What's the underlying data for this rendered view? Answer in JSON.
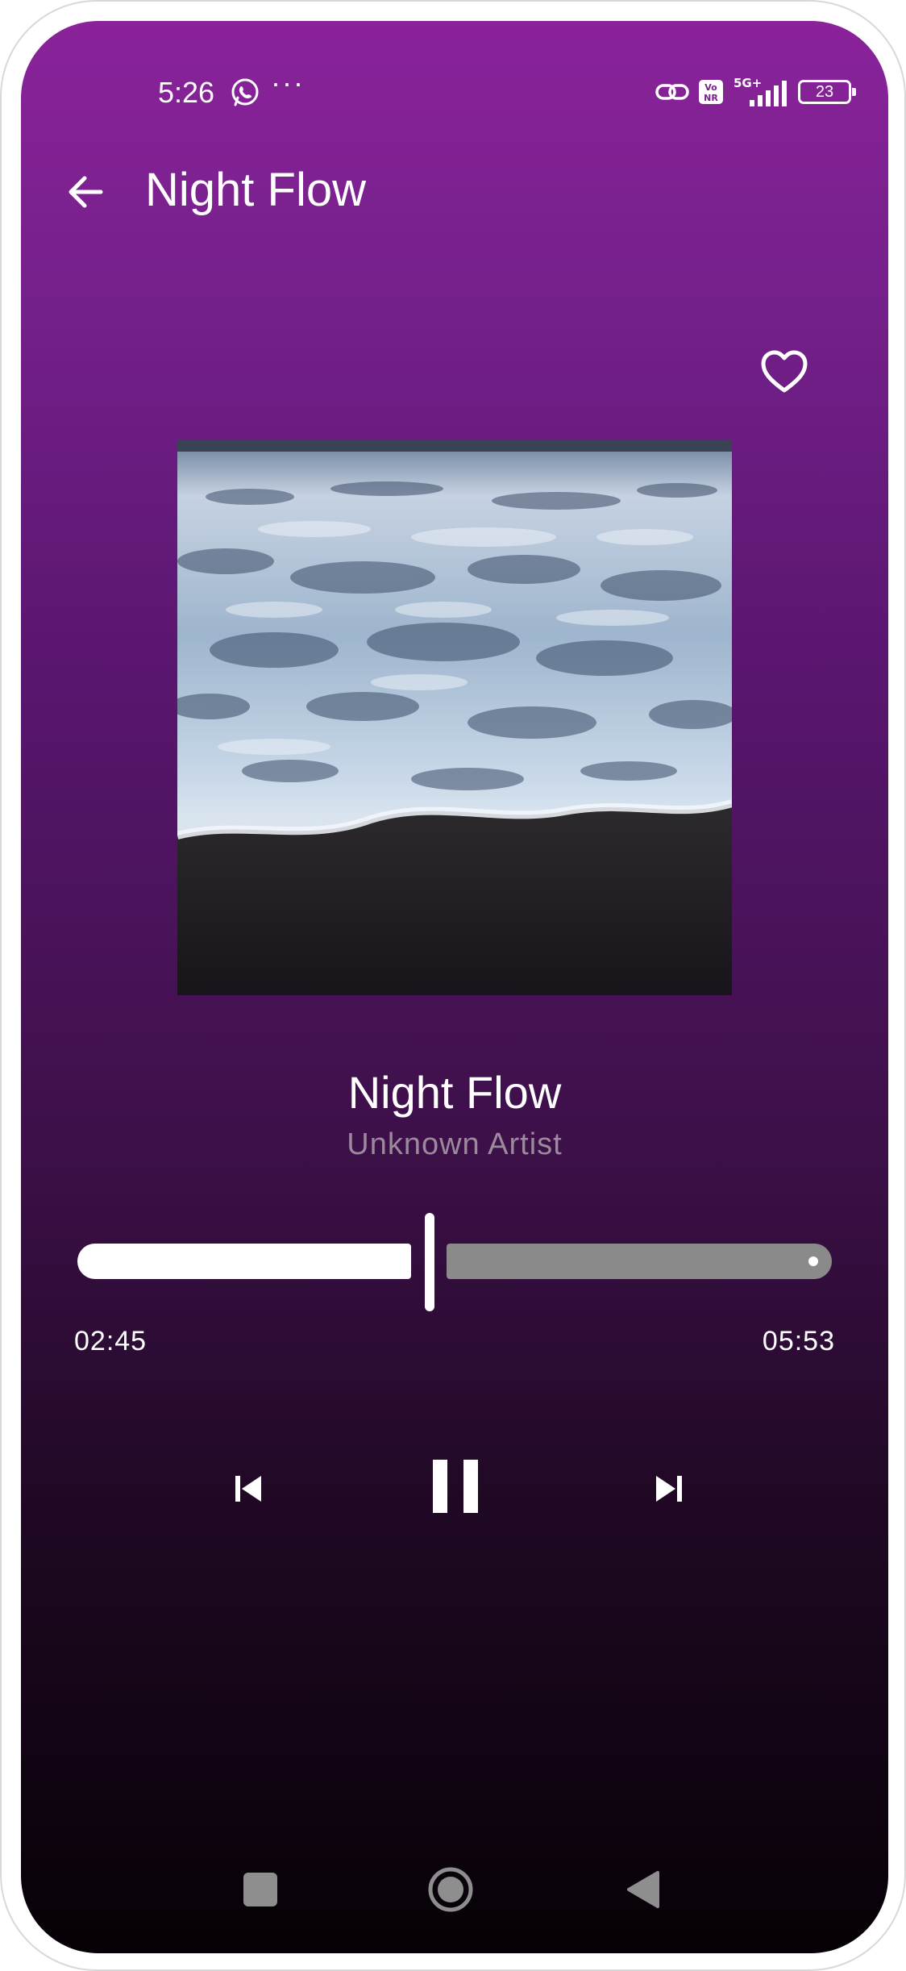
{
  "status_bar": {
    "time": "5:26",
    "dots": "···",
    "battery": "23",
    "network": "5G+",
    "volte": "Vo NR"
  },
  "app_bar": {
    "title": "Night Flow",
    "back_icon": "arrow-left-icon"
  },
  "favorite": {
    "icon": "heart-outline-icon",
    "active": false
  },
  "track": {
    "title": "Night Flow",
    "artist": "Unknown Artist",
    "album_art": "ocean-foam-on-sand-image"
  },
  "progress": {
    "elapsed": "02:45",
    "total": "05:53",
    "fraction": 0.467
  },
  "controls": {
    "previous_icon": "skip-previous-icon",
    "play_pause_icon": "pause-icon",
    "next_icon": "skip-next-icon"
  },
  "nav_bar": {
    "recents_icon": "square-icon",
    "home_icon": "circle-icon",
    "back_icon": "triangle-back-icon"
  },
  "colors": {
    "gradient_top": "#8a229a",
    "gradient_bottom": "#060106",
    "progress_played": "#ffffff",
    "progress_remaining": "#8a8a8a",
    "artist_text": "#9c8a9c"
  }
}
